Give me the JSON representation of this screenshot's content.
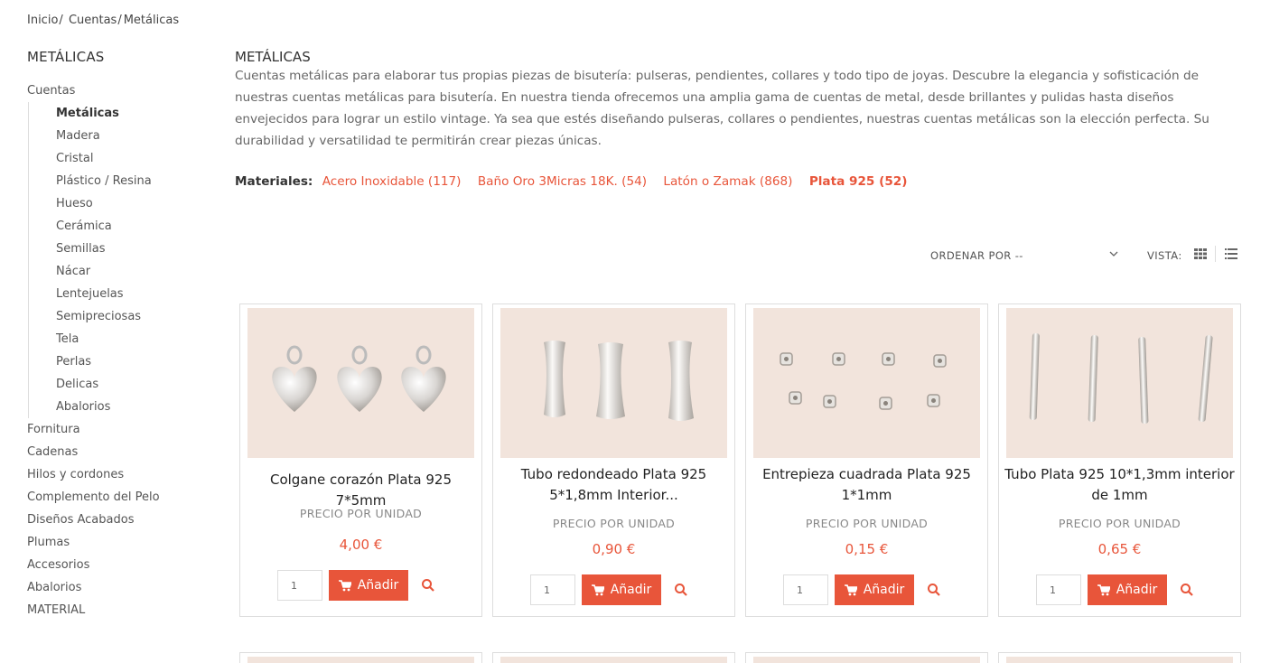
{
  "breadcrumb": {
    "home": "Inicio",
    "parent": "Cuentas",
    "current": "Metálicas"
  },
  "sidebar": {
    "title": "METÁLICAS",
    "root": "Cuentas",
    "subitems": [
      "Metálicas",
      "Madera",
      "Cristal",
      "Plástico / Resina",
      "Hueso",
      "Cerámica",
      "Semillas",
      "Nácar",
      "Lentejuelas",
      "Semipreciosas",
      "Tela",
      "Perlas",
      "Delicas",
      "Abalorios"
    ],
    "items": [
      "Fornitura",
      "Cadenas",
      "Hilos y cordones",
      "Complemento del Pelo",
      "Diseños Acabados",
      "Plumas",
      "Accesorios",
      "Abalorios",
      "MATERIAL"
    ]
  },
  "category": {
    "title": "METÁLICAS",
    "description": "Cuentas metálicas para elaborar tus propias piezas de bisutería: pulseras, pendientes, collares y todo tipo de joyas. Descubre la elegancia y sofisticación de nuestras cuentas metálicas para bisutería. En nuestra tienda ofrecemos una amplia gama de cuentas de metal, desde brillantes y pulidas hasta diseños envejecidos para lograr un estilo vintage. Ya sea que estés diseñando pulseras, collares o pendientes, nuestras cuentas metálicas son la elección perfecta. Su durabilidad y versatilidad te permitirán crear piezas únicas."
  },
  "materials": {
    "label": "Materiales:",
    "options": [
      {
        "label": "Acero Inoxidable (117)",
        "selected": false
      },
      {
        "label": "Baño Oro 3Micras 18K. (54)",
        "selected": false
      },
      {
        "label": "Latón o Zamak (868)",
        "selected": false
      },
      {
        "label": "Plata 925 (52)",
        "selected": true
      }
    ]
  },
  "toolbar": {
    "sort_label": "ORDENAR POR --",
    "view_label": "VISTA:"
  },
  "products": [
    {
      "name": "Colgane corazón Plata 925 7*5mm",
      "unit_label": "PRECIO POR UNIDAD",
      "price": "4,00 €",
      "qty": "1",
      "add_label": "Añadir"
    },
    {
      "name": "Tubo redondeado Plata 925 5*1,8mm Interior...",
      "unit_label": "PRECIO POR UNIDAD",
      "price": "0,90 €",
      "qty": "1",
      "add_label": "Añadir"
    },
    {
      "name": "Entrepieza cuadrada Plata 925 1*1mm",
      "unit_label": "PRECIO POR UNIDAD",
      "price": "0,15 €",
      "qty": "1",
      "add_label": "Añadir"
    },
    {
      "name": "Tubo Plata 925 10*1,3mm interior de 1mm",
      "unit_label": "PRECIO POR UNIDAD",
      "price": "0,65 €",
      "qty": "1",
      "add_label": "Añadir"
    }
  ],
  "colors": {
    "accent": "#e8553a",
    "image_bg": "#f2e4dc",
    "border": "#dddddd"
  }
}
